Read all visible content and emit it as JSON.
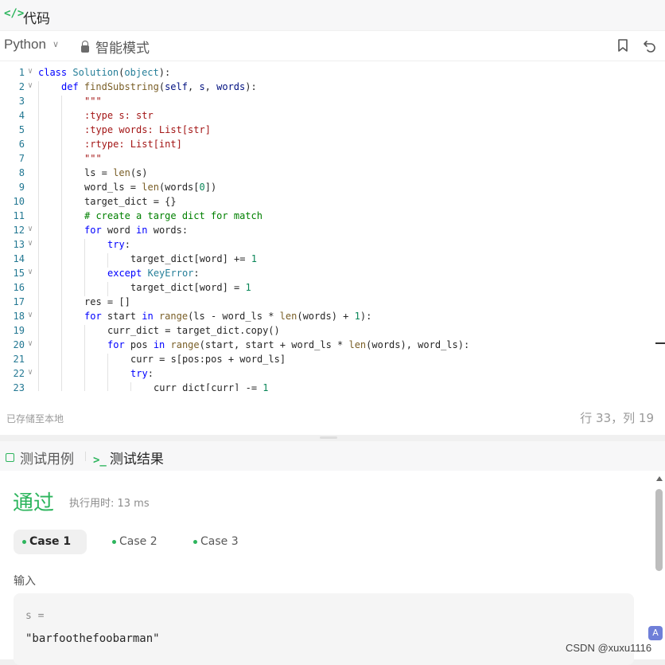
{
  "tab": {
    "icon": "code-icon",
    "icon_glyph": "</>",
    "title": "代码"
  },
  "toolbar": {
    "language": "Python",
    "mode": "智能模式",
    "bookmark_icon": "bookmark-icon",
    "reset_icon": "undo-icon"
  },
  "editor": {
    "lines": [
      {
        "n": "1",
        "fold": true,
        "depth": 0,
        "html": "<span class='kw'>class</span> <span class='cls'>Solution</span>(<span class='cls'>object</span>):"
      },
      {
        "n": "2",
        "fold": true,
        "depth": 1,
        "html": "<span class='kw'>def</span> <span class='fn'>findSubstring</span>(<span class='par'>self</span>, <span class='par'>s</span>, <span class='par'>words</span>):"
      },
      {
        "n": "3",
        "fold": false,
        "depth": 2,
        "html": "<span class='str'>\"\"\"</span>"
      },
      {
        "n": "4",
        "fold": false,
        "depth": 2,
        "html": "<span class='str'>:type s: str</span>"
      },
      {
        "n": "5",
        "fold": false,
        "depth": 2,
        "html": "<span class='str'>:type words: List[str]</span>"
      },
      {
        "n": "6",
        "fold": false,
        "depth": 2,
        "html": "<span class='str'>:rtype: List[int]</span>"
      },
      {
        "n": "7",
        "fold": false,
        "depth": 2,
        "html": "<span class='str'>\"\"\"</span>"
      },
      {
        "n": "8",
        "fold": false,
        "depth": 2,
        "html": "ls = <span class='fn'>len</span>(s)"
      },
      {
        "n": "9",
        "fold": false,
        "depth": 2,
        "html": "word_ls = <span class='fn'>len</span>(words[<span class='num'>0</span>])"
      },
      {
        "n": "10",
        "fold": false,
        "depth": 2,
        "html": "target_dict = {}"
      },
      {
        "n": "11",
        "fold": false,
        "depth": 2,
        "html": "<span class='cm'># create a targe dict for match</span>"
      },
      {
        "n": "12",
        "fold": true,
        "depth": 2,
        "html": "<span class='kw'>for</span> word <span class='kw'>in</span> words:"
      },
      {
        "n": "13",
        "fold": true,
        "depth": 3,
        "html": "<span class='kw'>try</span>:"
      },
      {
        "n": "14",
        "fold": false,
        "depth": 4,
        "html": "target_dict[word] += <span class='num'>1</span>"
      },
      {
        "n": "15",
        "fold": true,
        "depth": 3,
        "html": "<span class='kw'>except</span> <span class='cls'>KeyError</span>:"
      },
      {
        "n": "16",
        "fold": false,
        "depth": 4,
        "html": "target_dict[word] = <span class='num'>1</span>"
      },
      {
        "n": "17",
        "fold": false,
        "depth": 2,
        "html": "res = []"
      },
      {
        "n": "18",
        "fold": true,
        "depth": 2,
        "html": "<span class='kw'>for</span> start <span class='kw'>in</span> <span class='fn'>range</span>(ls - word_ls * <span class='fn'>len</span>(words) + <span class='num'>1</span>):"
      },
      {
        "n": "19",
        "fold": false,
        "depth": 3,
        "html": "curr_dict = target_dict.copy()"
      },
      {
        "n": "20",
        "fold": true,
        "depth": 3,
        "html": "<span class='kw'>for</span> pos <span class='kw'>in</span> <span class='fn'>range</span>(start, start + word_ls * <span class='fn'>len</span>(words), word_ls):"
      },
      {
        "n": "21",
        "fold": false,
        "depth": 4,
        "html": "curr = s[pos:pos + word_ls]"
      },
      {
        "n": "22",
        "fold": true,
        "depth": 4,
        "html": "<span class='kw'>try</span>:"
      },
      {
        "n": "23",
        "fold": false,
        "depth": 5,
        "html": "curr_dict[curr] -= <span class='num'>1</span>"
      }
    ]
  },
  "status": {
    "saved": "已存储至本地",
    "cursor": "行 33，列 19"
  },
  "bottom_tabs": {
    "cases": "测试用例",
    "results": "测试结果",
    "results_icon_glyph": ">_"
  },
  "result": {
    "verdict": "通过",
    "runtime": "执行用时: 13 ms",
    "cases": [
      "Case 1",
      "Case 2",
      "Case 3"
    ],
    "active_case": 0,
    "input_label": "输入",
    "input_key": "s =",
    "input_value": "\"barfoothefoobarman\""
  },
  "watermark": "CSDN @xuxu1116",
  "colors": {
    "accent": "#2db55d"
  }
}
